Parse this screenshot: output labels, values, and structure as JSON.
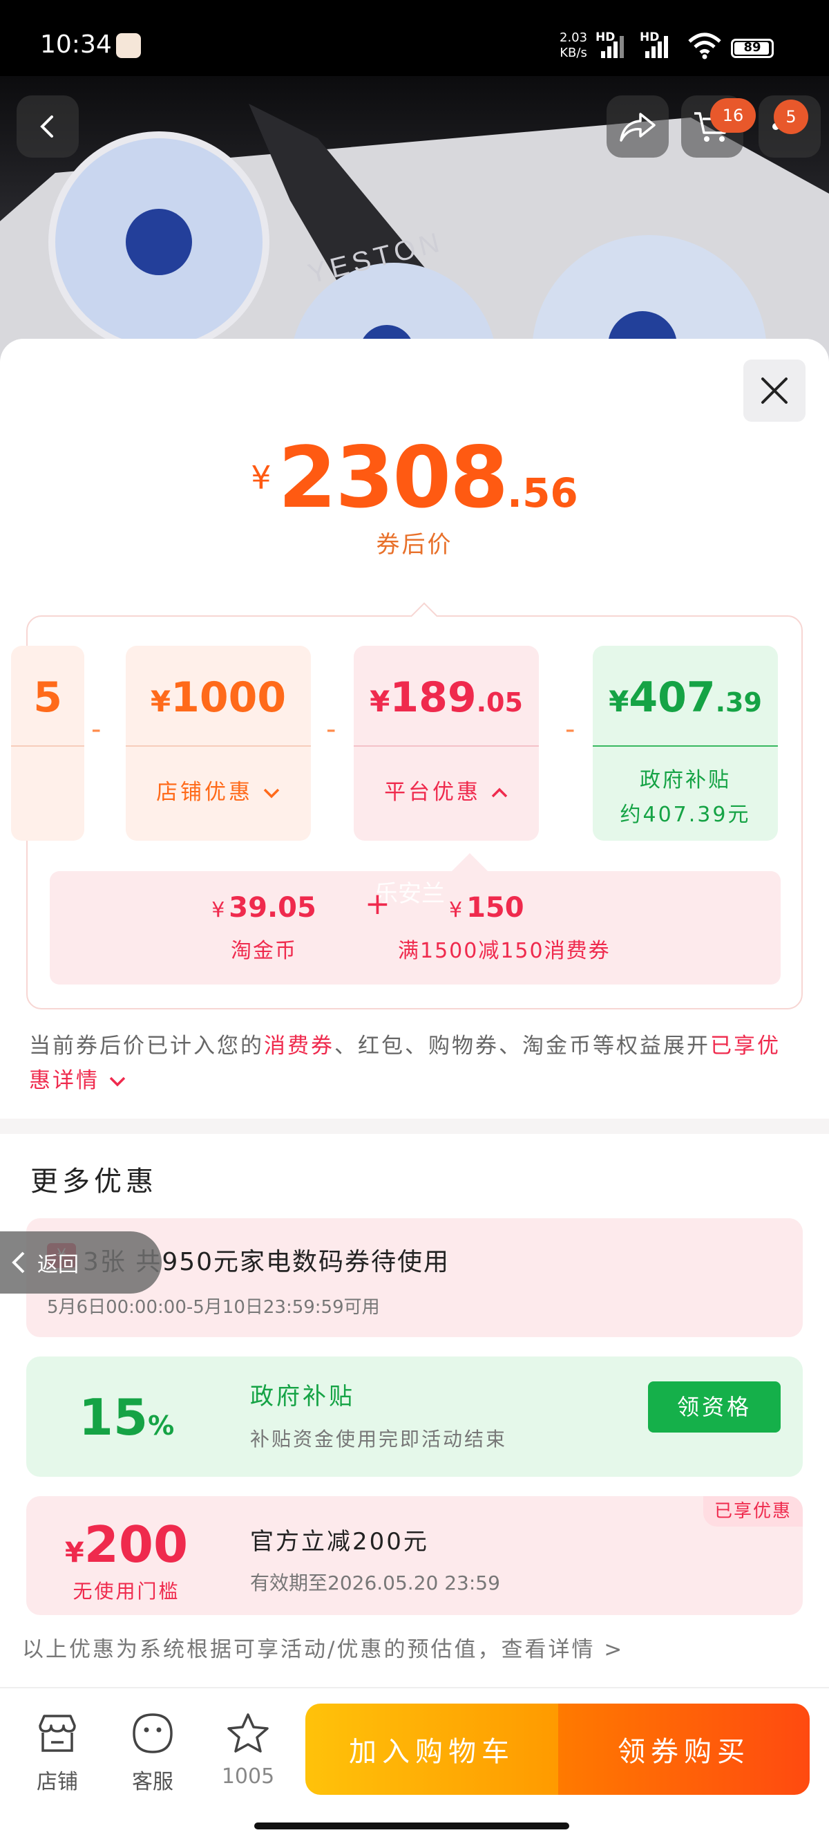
{
  "status_bar": {
    "time": "10:34",
    "net_speed_value": "2.03",
    "net_speed_unit": "KB/s",
    "hd_1": "HD",
    "hd_2": "HD",
    "battery": "89"
  },
  "header": {
    "cart_badge": "16",
    "more_badge": "5"
  },
  "price": {
    "currency": "¥",
    "integer": "2308",
    "decimal": ".56",
    "caption": "券后价"
  },
  "breakdown": {
    "partial_value": "5",
    "cards": [
      {
        "currency": "¥",
        "integer": "1000",
        "decimal": "",
        "label": "店铺优惠",
        "style": "orange"
      },
      {
        "currency": "¥",
        "integer": "189",
        "decimal": ".05",
        "label": "平台优惠",
        "style": "pink"
      },
      {
        "currency": "¥",
        "integer": "407",
        "decimal": ".39",
        "label_line1": "政府补贴",
        "label_line2": "约407.39元",
        "style": "green"
      }
    ],
    "minus": "-",
    "platform_detail": {
      "item1_currency": "¥",
      "item1_value": "39.05",
      "item1_label": "淘金币",
      "plus": "+",
      "item2_currency": "¥",
      "item2_value": "150",
      "item2_label": "满1500减150消费券",
      "watermark": "乐安兰"
    }
  },
  "note": {
    "prefix": "当前券后价已计入您的",
    "highlight": "消费券",
    "middle": "、红包、购物券、淘金币等权益展开",
    "link": "已享优惠详情"
  },
  "more_offers": {
    "title": "更多优惠",
    "coupon_icon": "¥",
    "coupon": {
      "title": "3张 共950元家电数码券待使用",
      "validity": "5月6日00:00:00-5月10日23:59:59可用"
    },
    "subsidy": {
      "percent": "15",
      "percent_unit": "%",
      "title": "政府补贴",
      "subtitle": "补贴资金使用完即活动结束",
      "button": "领资格"
    },
    "discount": {
      "currency": "¥",
      "amount": "200",
      "threshold": "无使用门槛",
      "title": "官方立减200元",
      "validity": "有效期至2026.05.20 23:59",
      "tag": "已享优惠"
    },
    "disclaimer": "以上优惠为系统根据可享活动/优惠的预估值，查看详情 >"
  },
  "back_pill": {
    "label": "返回"
  },
  "bottom_bar": {
    "store": "店铺",
    "service": "客服",
    "favorites": "1005",
    "add_to_cart": "加入购物车",
    "buy_with_coupon": "领券购买"
  },
  "colors": {
    "price_orange": "#ff5a12",
    "coupon_red": "#ef2a4d",
    "subsidy_green": "#15a345",
    "cta_yellow": "#ffc20a",
    "cta_orange": "#ff4a10"
  }
}
